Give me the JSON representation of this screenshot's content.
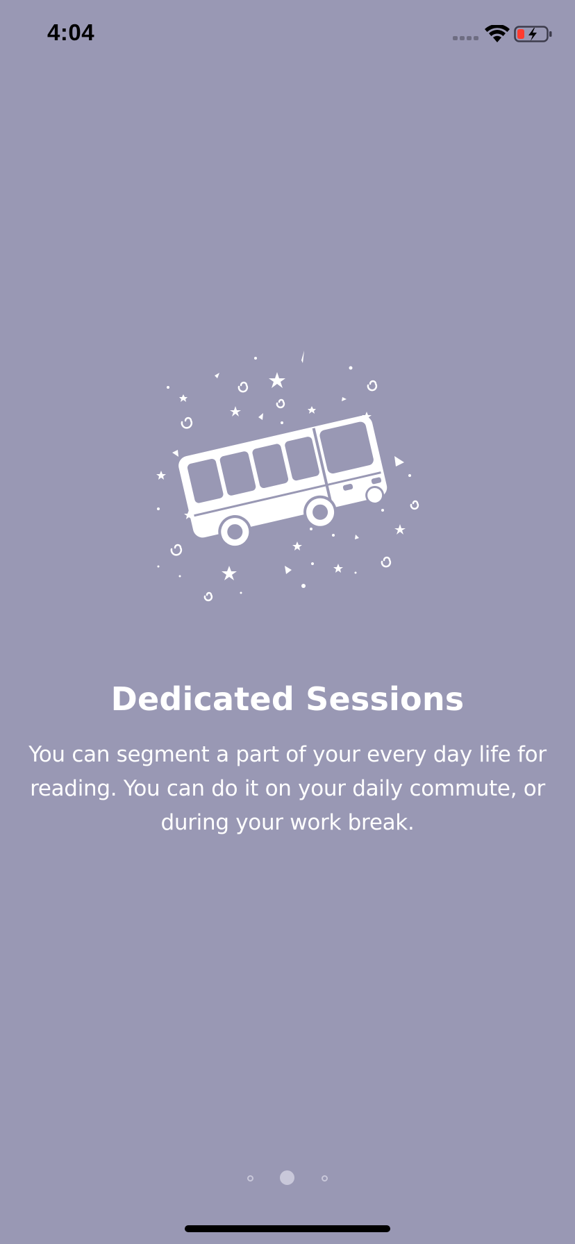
{
  "status_bar": {
    "time": "4:04",
    "signal_icon": "cellular-signal-icon",
    "wifi_icon": "wifi-icon",
    "battery_icon": "battery-charging-icon",
    "battery_low_color": "#ff3b30"
  },
  "onboarding": {
    "illustration": "bus-in-space-illustration",
    "title": "Dedicated Sessions",
    "description": "You can segment a part of your every day life for reading. You can do it on your daily commute, or during your work break."
  },
  "page_indicator": {
    "pages": 3,
    "current_page": 2
  },
  "colors": {
    "background": "#9998b4",
    "text": "#ffffff",
    "dot": "#c9c8da"
  }
}
